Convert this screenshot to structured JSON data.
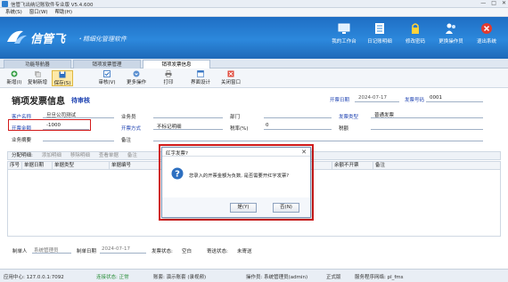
{
  "window": {
    "title": "信管飞出纳记账软件专业版 V5.4.600",
    "min": "—",
    "max": "□",
    "close": "✕"
  },
  "menu": [
    "系统(S)",
    "窗口(W)",
    "帮助(H)"
  ],
  "banner": {
    "brand": "信管飞",
    "slogan": "・精细化管理软件",
    "tools": [
      {
        "label": "我的工作台",
        "icon": "monitor-icon"
      },
      {
        "label": "日记账明细",
        "icon": "ledger-icon"
      },
      {
        "label": "修改密码",
        "icon": "lock-icon"
      },
      {
        "label": "更换操作员",
        "icon": "users-icon"
      },
      {
        "label": "退出系统",
        "icon": "exit-icon"
      }
    ]
  },
  "tabs": [
    {
      "label": "功能导航器",
      "active": false
    },
    {
      "label": "销项发票管理",
      "active": false
    },
    {
      "label": "销项发票信息",
      "active": true
    }
  ],
  "toolbar": [
    {
      "label": "新增(I)",
      "icon": "add-icon"
    },
    {
      "label": "复制新增",
      "icon": "copy-icon"
    },
    {
      "label": "保存(S)",
      "icon": "save-icon"
    },
    {
      "label": "审核(V)",
      "icon": "check-icon"
    },
    {
      "label": "更多操作",
      "icon": "more-icon"
    },
    {
      "label": "打印",
      "icon": "print-icon"
    },
    {
      "label": "界面设计",
      "icon": "design-icon"
    },
    {
      "label": "关闭窗口",
      "icon": "close-window-icon"
    }
  ],
  "form": {
    "doc_title": "销项发票信息",
    "doc_status": "待审核",
    "open_date_label": "开票日期",
    "open_date": "2024-07-17",
    "invoice_no_label": "发票号码",
    "invoice_no": "0001",
    "customer_label": "客户名称",
    "customer": "旦旦公司测试",
    "salesman_label": "业务员",
    "dept_label": "部门",
    "invoice_type_label": "发票类型",
    "invoice_type": "普通发票",
    "amount_label": "开票金额",
    "amount": "-1000",
    "method_label": "开票方式",
    "method": "不标记明细",
    "tax_label": "税率(%)",
    "tax": "0",
    "tax_amount_label": "税额",
    "summary_label": "业务摘要",
    "remark_label": "备注"
  },
  "detail_toolbar": [
    {
      "label": "分配明细:",
      "on": true
    },
    {
      "label": "添加明细",
      "on": false
    },
    {
      "label": "移除明细",
      "on": false
    },
    {
      "label": "查看单据",
      "on": false
    },
    {
      "label": "备注",
      "on": false
    }
  ],
  "grid_columns": [
    "序号",
    "单据日期",
    "单据类型",
    "单据编号",
    "余额不开票",
    "备注"
  ],
  "footer": {
    "maker_label": "制单人",
    "maker": "系统管理员",
    "make_date_label": "制单日期",
    "make_date": "2024-07-17",
    "invoice_state_label": "发票状态:",
    "invoice_state": "空白",
    "send_state_label": "寄送状态:",
    "send_state": "未寄送"
  },
  "status": {
    "app_center": "应用中心: 127.0.0.1:7092",
    "conn": "连接状态: 正常",
    "account": "账套: 演示账套 (录视频)",
    "operator": "操作员: 系统管理员(admin)",
    "edition": "正式版",
    "prog": "服务程序网络: pl_fms"
  },
  "dialog": {
    "title": "红字发票?",
    "close": "✕",
    "message": "您录入的开票金额为负数, 是否需要开红字发票?",
    "yes": "是(Y)",
    "no": "否(N)"
  },
  "colors": {
    "banner": "#2c88dc",
    "highlight_red": "#d21b1b",
    "label_blue": "#1a3fb0"
  }
}
